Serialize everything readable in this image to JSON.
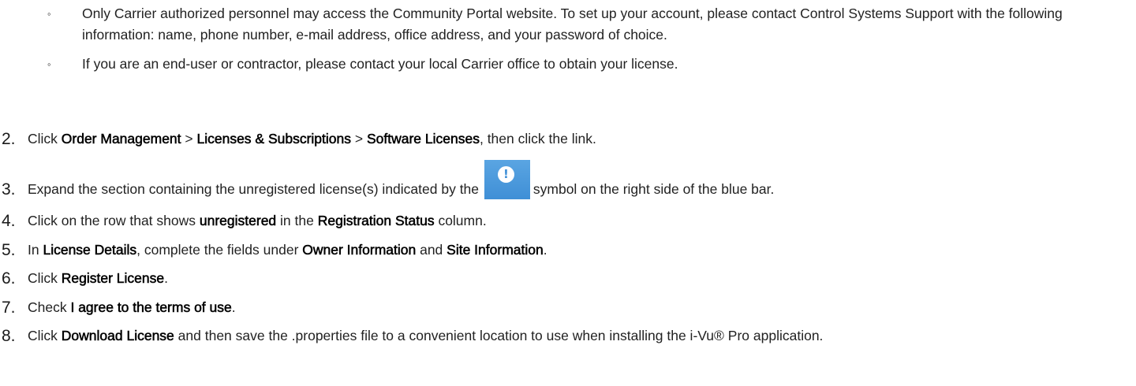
{
  "bullets": [
    {
      "marker": "◦",
      "text": "Only Carrier authorized personnel may access the Community Portal website. To set up your account, please contact Control Systems Support with the following information: name, phone number, e-mail address, office address, and your password of choice."
    },
    {
      "marker": "◦",
      "text": "If you are an end-user or contractor, please contact your local Carrier office to obtain your license."
    }
  ],
  "steps": [
    {
      "number": "2.",
      "parts": [
        "Click ",
        "Order Management",
        " > ",
        "Licenses & Subscriptions",
        " > ",
        "Software Licenses",
        ", then click the link."
      ]
    },
    {
      "number": "3.",
      "parts": [
        "Expand the section containing the unregistered license(s) indicated by the ",
        "symbol on the right side of the blue bar."
      ],
      "icon": "unregistered-alert-icon",
      "icon_glyph": "!",
      "icon_color": "#3f8fd6"
    },
    {
      "number": "4.",
      "parts": [
        "Click on the row that shows ",
        "unregistered",
        " in the ",
        "Registration Status",
        " column."
      ]
    },
    {
      "number": "5.",
      "parts": [
        "In ",
        "License Details",
        ", complete the fields under ",
        "Owner Information",
        " and ",
        "Site Information",
        "."
      ]
    },
    {
      "number": "6.",
      "parts": [
        "Click ",
        "Register License",
        "."
      ]
    },
    {
      "number": "7.",
      "parts": [
        "Check ",
        "I agree to the terms of use",
        "."
      ]
    },
    {
      "number": "8.",
      "parts": [
        "Click ",
        "Download License",
        " and then save the .properties file to a convenient location to use when installing the i-Vu® Pro application."
      ]
    }
  ]
}
